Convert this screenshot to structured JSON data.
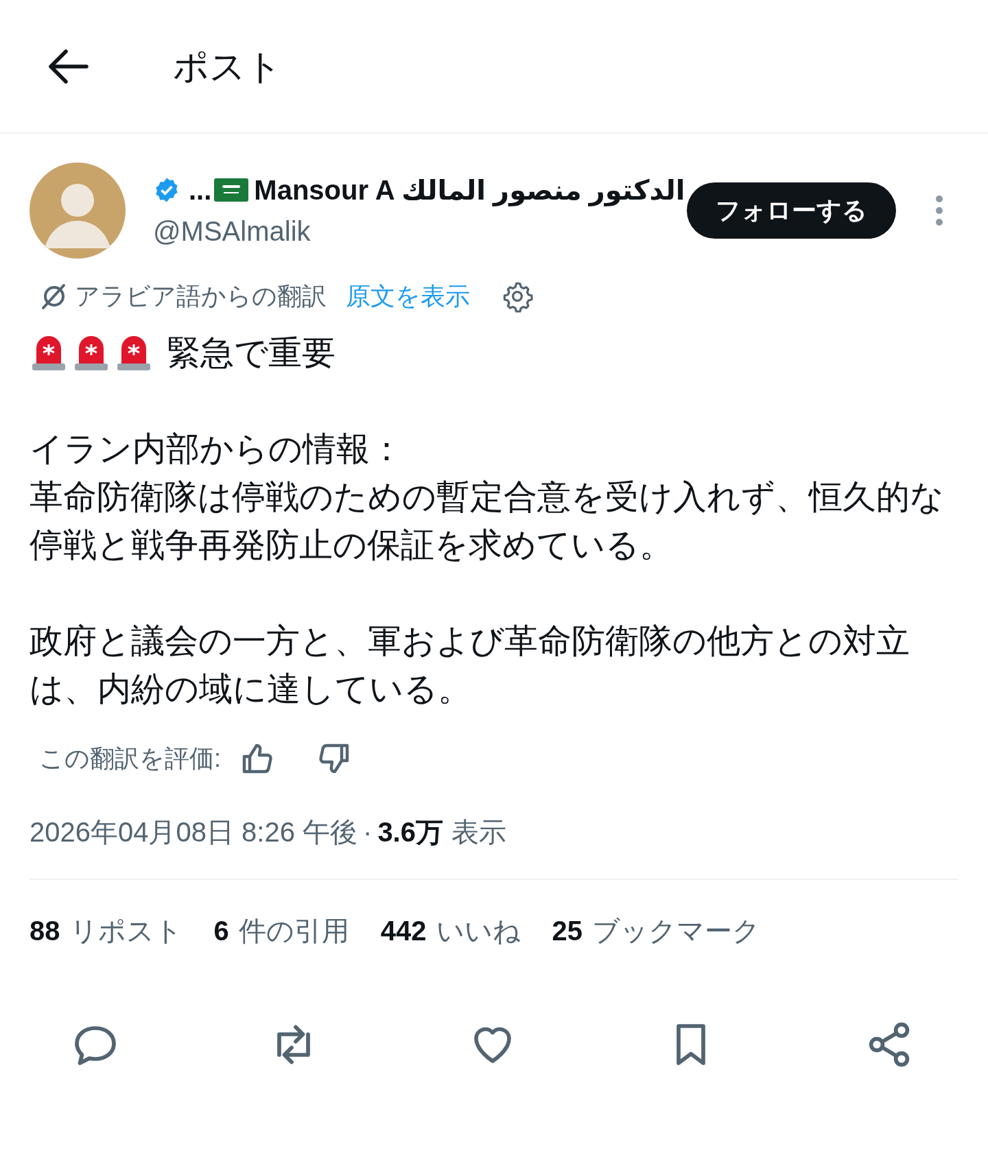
{
  "header": {
    "title": "ポスト"
  },
  "author": {
    "name_prefix": "...",
    "name": "Mansour A الدكتور منصور المالك",
    "handle": "@MSAlmalik",
    "verified": true
  },
  "follow_button": "フォローする",
  "translation": {
    "label": "アラビア語からの翻訳",
    "link": "原文を表示"
  },
  "body": [
    {
      "kind": "alert",
      "lines": [
        "緊急で重要"
      ]
    },
    {
      "kind": "text",
      "lines": [
        "イラン内部からの情報：",
        "革命防衛隊は停戦のための暫定合意を受け入れず、恒久的な停戦と戦争再発防止の保証を求めている。"
      ]
    },
    {
      "kind": "text",
      "lines": [
        "政府と議会の一方と、軍および革命防衛隊の他方との対立は、内紛の域に達している。"
      ]
    }
  ],
  "rating": {
    "label": "この翻訳を評価:"
  },
  "meta": {
    "datetime": "2026年04月08日 8:26 午後",
    "separator": "·",
    "views_count": "3.6万",
    "views_label": "表示"
  },
  "stats": [
    {
      "count": "88",
      "label": "リポスト"
    },
    {
      "count": "6",
      "label": "件の引用"
    },
    {
      "count": "442",
      "label": "いいね"
    },
    {
      "count": "25",
      "label": "ブックマーク"
    }
  ],
  "actions": [
    {
      "kind": "reply"
    },
    {
      "kind": "repost"
    },
    {
      "kind": "like"
    },
    {
      "kind": "bookmark"
    },
    {
      "kind": "share"
    }
  ]
}
